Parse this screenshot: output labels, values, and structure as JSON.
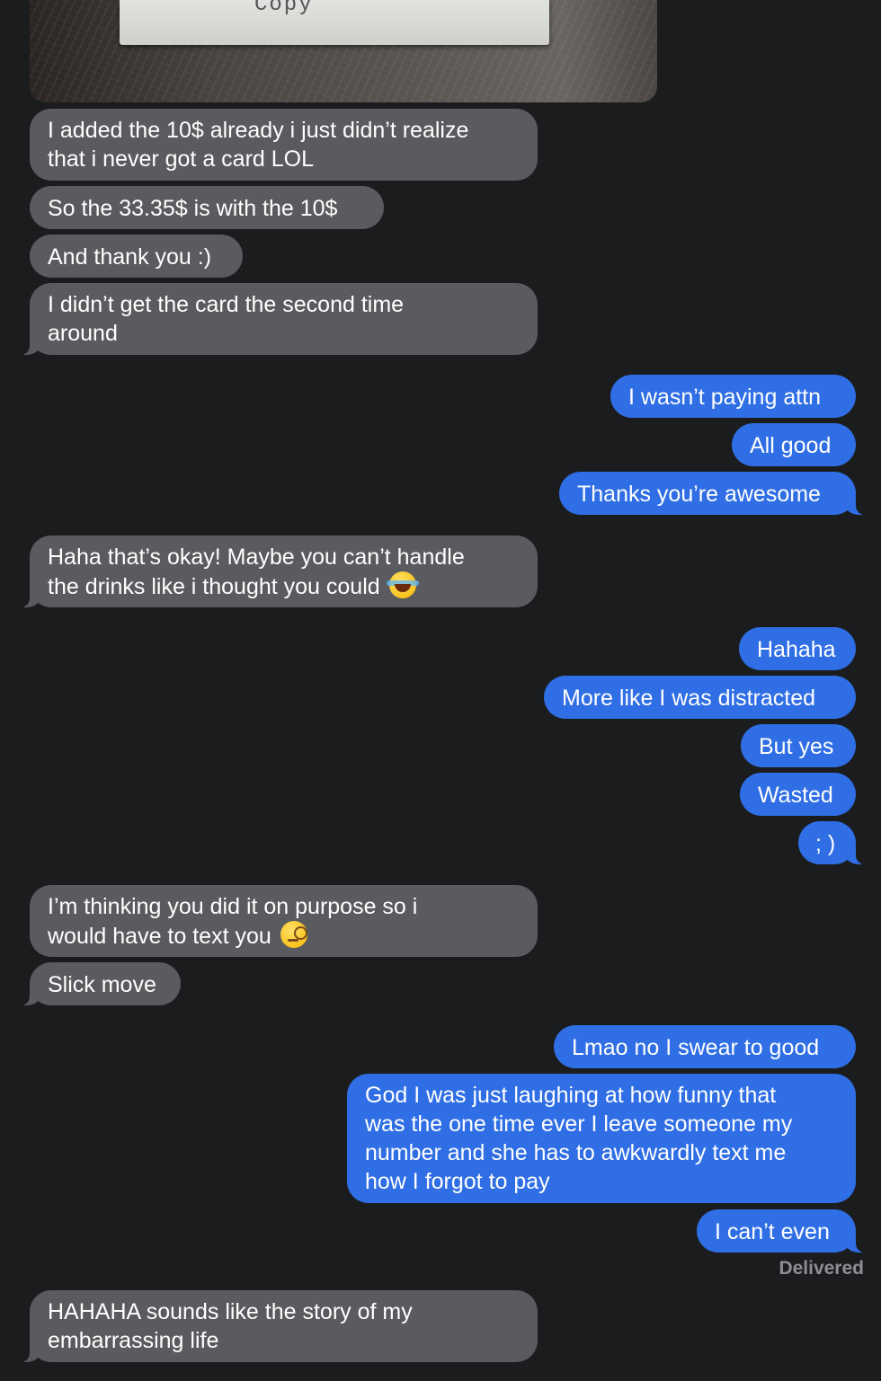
{
  "photo": {
    "caption": "Copy"
  },
  "messages": [
    {
      "dir": "received",
      "lines": [
        "I added the 10$ already i just didn’t realize",
        "that i never got a card LOL"
      ]
    },
    {
      "dir": "received",
      "text": "So the 33.35$ is with the 10$"
    },
    {
      "dir": "received",
      "text": "And thank you :)"
    },
    {
      "dir": "received",
      "lines": [
        "I didn’t get the card the second time",
        "around"
      ]
    },
    {
      "dir": "sent",
      "text": "I wasn’t paying attn"
    },
    {
      "dir": "sent",
      "text": "All good"
    },
    {
      "dir": "sent",
      "text": "Thanks you’re awesome"
    },
    {
      "dir": "received",
      "lines": [
        "Haha that’s okay! Maybe you can’t handle",
        "the drinks like i thought you could"
      ],
      "emoji": "face-with-tears-of-joy-icon"
    },
    {
      "dir": "sent",
      "text": "Hahaha"
    },
    {
      "dir": "sent",
      "text": "More like I was distracted"
    },
    {
      "dir": "sent",
      "text": "But yes"
    },
    {
      "dir": "sent",
      "text": "Wasted"
    },
    {
      "dir": "sent",
      "text": "; )"
    },
    {
      "dir": "received",
      "lines": [
        "I’m thinking you did it on purpose so i",
        "would have to text you"
      ],
      "emoji": "face-with-monocle-icon"
    },
    {
      "dir": "received",
      "text": "Slick move"
    },
    {
      "dir": "sent",
      "text": "Lmao no I swear to good"
    },
    {
      "dir": "sent",
      "lines": [
        "God I was just laughing at how funny that",
        "was the one time ever I leave someone my",
        "number and she has to awkwardly text me",
        "how I forgot to pay"
      ]
    },
    {
      "dir": "sent",
      "text": "I can’t even"
    },
    {
      "dir": "received",
      "lines": [
        "HAHAHA sounds like the story of my",
        "embarrassing life"
      ]
    }
  ],
  "status": {
    "delivered_label": "Delivered"
  },
  "colors": {
    "background": "#1b1c1e",
    "received_bubble": "#5a5b5e",
    "sent_bubble": "#2f6ee4",
    "status_text": "#8e8e93"
  }
}
